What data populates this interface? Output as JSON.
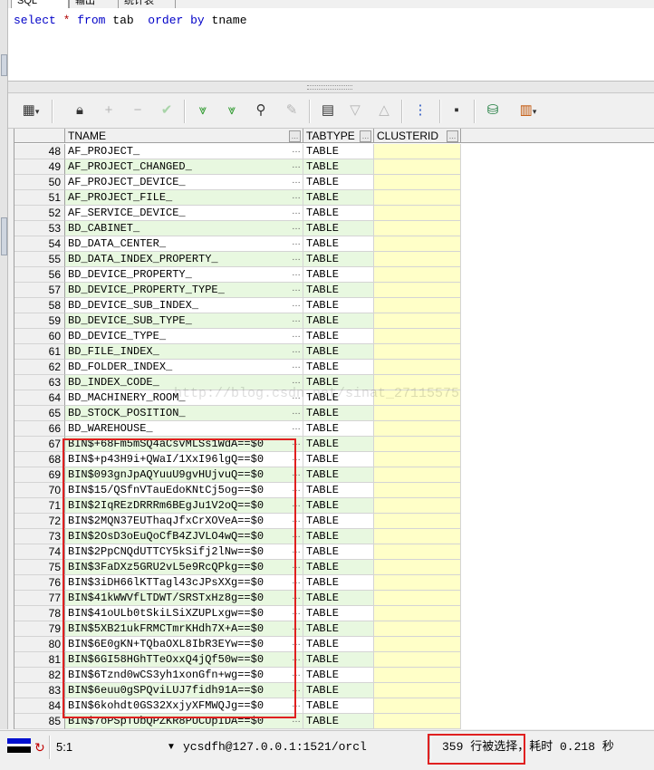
{
  "tabs": [
    "SQL",
    "输出",
    "统计表"
  ],
  "sql": {
    "kw_select": "select",
    "star": "*",
    "kw_from": "from",
    "table": "tab",
    "kw_order_by": "order by",
    "column": "tname"
  },
  "columns": {
    "tname": "TNAME",
    "tabtype": "TABTYPE",
    "clusterid": "CLUSTERID"
  },
  "rows": [
    {
      "n": "48",
      "tname": "AF_PROJECT_",
      "type": "TABLE"
    },
    {
      "n": "49",
      "tname": "AF_PROJECT_CHANGED_",
      "type": "TABLE"
    },
    {
      "n": "50",
      "tname": "AF_PROJECT_DEVICE_",
      "type": "TABLE"
    },
    {
      "n": "51",
      "tname": "AF_PROJECT_FILE_",
      "type": "TABLE"
    },
    {
      "n": "52",
      "tname": "AF_SERVICE_DEVICE_",
      "type": "TABLE"
    },
    {
      "n": "53",
      "tname": "BD_CABINET_",
      "type": "TABLE"
    },
    {
      "n": "54",
      "tname": "BD_DATA_CENTER_",
      "type": "TABLE"
    },
    {
      "n": "55",
      "tname": "BD_DATA_INDEX_PROPERTY_",
      "type": "TABLE"
    },
    {
      "n": "56",
      "tname": "BD_DEVICE_PROPERTY_",
      "type": "TABLE"
    },
    {
      "n": "57",
      "tname": "BD_DEVICE_PROPERTY_TYPE_",
      "type": "TABLE"
    },
    {
      "n": "58",
      "tname": "BD_DEVICE_SUB_INDEX_",
      "type": "TABLE"
    },
    {
      "n": "59",
      "tname": "BD_DEVICE_SUB_TYPE_",
      "type": "TABLE"
    },
    {
      "n": "60",
      "tname": "BD_DEVICE_TYPE_",
      "type": "TABLE"
    },
    {
      "n": "61",
      "tname": "BD_FILE_INDEX_",
      "type": "TABLE"
    },
    {
      "n": "62",
      "tname": "BD_FOLDER_INDEX_",
      "type": "TABLE"
    },
    {
      "n": "63",
      "tname": "BD_INDEX_CODE_",
      "type": "TABLE"
    },
    {
      "n": "64",
      "tname": "BD_MACHINERY_ROOM_",
      "type": "TABLE"
    },
    {
      "n": "65",
      "tname": "BD_STOCK_POSITION_",
      "type": "TABLE"
    },
    {
      "n": "66",
      "tname": "BD_WAREHOUSE_",
      "type": "TABLE"
    },
    {
      "n": "67",
      "tname": "BIN$+68Fm5mSQ4aCsvMLSs1WdA==$0",
      "type": "TABLE"
    },
    {
      "n": "68",
      "tname": "BIN$+p43H9i+QWaI/1XxI96lgQ==$0",
      "type": "TABLE"
    },
    {
      "n": "69",
      "tname": "BIN$093gnJpAQYuuU9gvHUjvuQ==$0",
      "type": "TABLE"
    },
    {
      "n": "70",
      "tname": "BIN$15/QSfnVTauEdoKNtCj5og==$0",
      "type": "TABLE"
    },
    {
      "n": "71",
      "tname": "BIN$2IqREzDRRRm6BEgJu1V2oQ==$0",
      "type": "TABLE"
    },
    {
      "n": "72",
      "tname": "BIN$2MQN37EUThaqJfxCrXOVeA==$0",
      "type": "TABLE"
    },
    {
      "n": "73",
      "tname": "BIN$2OsD3oEuQoCfB4ZJVLO4wQ==$0",
      "type": "TABLE"
    },
    {
      "n": "74",
      "tname": "BIN$2PpCNQdUTTCY5kSifj2lNw==$0",
      "type": "TABLE"
    },
    {
      "n": "75",
      "tname": "BIN$3FaDXz5GRU2vL5e9RcQPkg==$0",
      "type": "TABLE"
    },
    {
      "n": "76",
      "tname": "BIN$3iDH66lKTTagl43cJPsXXg==$0",
      "type": "TABLE"
    },
    {
      "n": "77",
      "tname": "BIN$41kWWVfLTDWT/SRSTxHz8g==$0",
      "type": "TABLE"
    },
    {
      "n": "78",
      "tname": "BIN$41oULb0tSkiLSiXZUPLxgw==$0",
      "type": "TABLE"
    },
    {
      "n": "79",
      "tname": "BIN$5XB21ukFRMCTmrKHdh7X+A==$0",
      "type": "TABLE"
    },
    {
      "n": "80",
      "tname": "BIN$6E0gKN+TQbaOXL8IbR3EYw==$0",
      "type": "TABLE"
    },
    {
      "n": "81",
      "tname": "BIN$6GI58HGhTTeOxxQ4jQf50w==$0",
      "type": "TABLE"
    },
    {
      "n": "82",
      "tname": "BIN$6Tznd0wCS3yh1xonGfn+wg==$0",
      "type": "TABLE"
    },
    {
      "n": "83",
      "tname": "BIN$6euu0gSPQviLUJ7fidh91A==$0",
      "type": "TABLE"
    },
    {
      "n": "84",
      "tname": "BIN$6kohdt0GS32XxjyXFMWQJg==$0",
      "type": "TABLE"
    },
    {
      "n": "85",
      "tname": "BIN$7oPSpTUbQPZKR8PUCUpIDA==$0",
      "type": "TABLE"
    }
  ],
  "watermark": "http://blog.csdn.net/sinat_27115575",
  "status": {
    "position": "5:1",
    "connection": "ycsdfh@127.0.0.1:1521/orcl",
    "result": "359 行被选择，耗时 0.218 秒"
  }
}
